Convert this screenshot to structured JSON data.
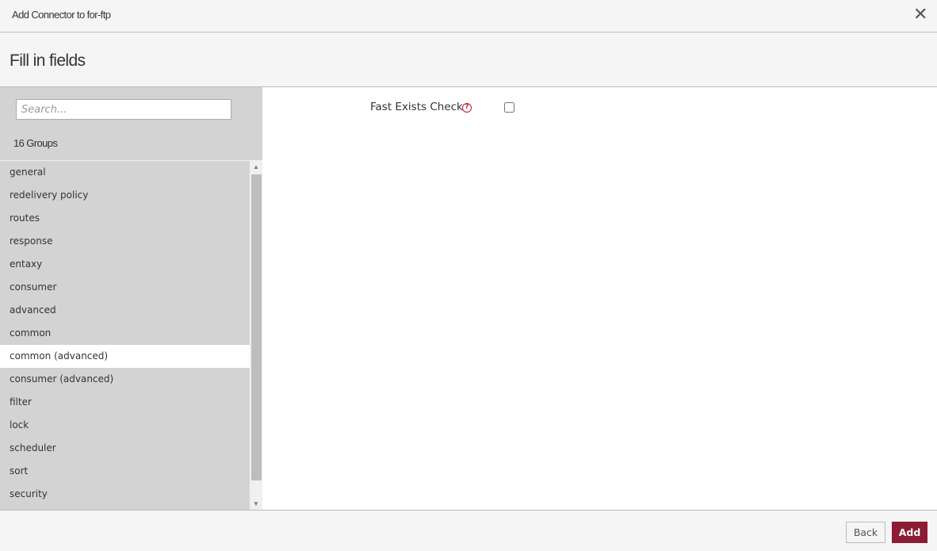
{
  "dialog": {
    "title": "Add Connector to for-ftp",
    "close_icon": "close-icon",
    "subtitle": "Fill in fields"
  },
  "sidebar": {
    "search_placeholder": "Search...",
    "search_value": "",
    "groups_count": "16 Groups",
    "active_index": 8,
    "items": [
      {
        "label": "general"
      },
      {
        "label": "redelivery policy"
      },
      {
        "label": "routes"
      },
      {
        "label": "response"
      },
      {
        "label": "entaxy"
      },
      {
        "label": "consumer"
      },
      {
        "label": "advanced"
      },
      {
        "label": "common"
      },
      {
        "label": "common (advanced)"
      },
      {
        "label": "consumer (advanced)"
      },
      {
        "label": "filter"
      },
      {
        "label": "lock"
      },
      {
        "label": "scheduler"
      },
      {
        "label": "sort"
      },
      {
        "label": "security"
      }
    ]
  },
  "main": {
    "fields": [
      {
        "label": "Fast Exists Check",
        "help_icon": "help-circle-icon",
        "type": "checkbox",
        "checked": false
      }
    ]
  },
  "footer": {
    "back_label": "Back",
    "add_label": "Add"
  },
  "colors": {
    "accent": "#8c1d34",
    "help_icon": "#c0142c",
    "sidebar_bg": "#d3d3d3",
    "active_item_bg": "#ffffff"
  }
}
